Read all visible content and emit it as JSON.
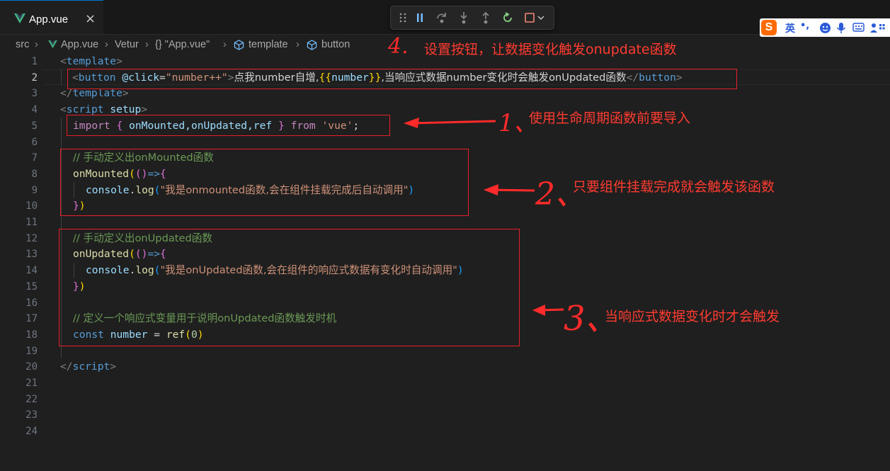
{
  "tab": {
    "filename": "App.vue",
    "close": "×"
  },
  "debug_toolbar": {
    "icons": [
      "drag-handle",
      "pause",
      "step-over",
      "step-into",
      "step-out",
      "restart",
      "stop"
    ]
  },
  "ime": {
    "mode": "英",
    "punct": "•,"
  },
  "breadcrumb": [
    "src",
    "App.vue",
    "Vetur",
    "{} \"App.vue\"",
    "template",
    "button"
  ],
  "gutter": {
    "line_numbers": [
      "1",
      "2",
      "3",
      "4",
      "5",
      "6",
      "7",
      "8",
      "9",
      "10",
      "11",
      "12",
      "13",
      "14",
      "15",
      "16",
      "17",
      "18",
      "19",
      "20",
      "21",
      "22",
      "23",
      "24"
    ],
    "active_line": "2"
  },
  "code": {
    "l1": {
      "open": "<",
      "tag": "template",
      "close": ">"
    },
    "l2": {
      "open": "<",
      "tag": "button",
      "attr": "@click",
      "eq": "=",
      "val": "\"number++\"",
      "gt": ">",
      "text": "点我number自增,",
      "mus_open": "{{",
      "var": "number",
      "mus_close": "}}",
      "text2": ",当响应式数据number变化时会触发onUpdated函数",
      "end_open": "</",
      "end_tag": "button",
      "end_close": ">"
    },
    "l3": {
      "open": "</",
      "tag": "template",
      "close": ">"
    },
    "l4": {
      "open": "<",
      "tag": "script",
      "attr": "setup",
      "close": ">"
    },
    "l5": {
      "kw": "import",
      "b1": "{",
      "names": " onMounted,onUpdated,ref ",
      "b2": "}",
      "from": "from",
      "mod": "'vue'",
      "semi": ";"
    },
    "l7": "// 手动定义出onMounted函数",
    "l8": {
      "fn": "onMounted",
      "p1": "(",
      "p2": "()",
      "arrow": "=>",
      "b": "{"
    },
    "l9": {
      "obj": "console",
      "dot": ".",
      "fn": "log",
      "p1": "(",
      "str": "\"我是onmounted函数,会在组件挂载完成后自动调用\"",
      "p2": ")"
    },
    "l10": {
      "b": "}",
      "p": ")"
    },
    "l12": "// 手动定义出onUpdated函数",
    "l13": {
      "fn": "onUpdated",
      "p1": "(",
      "p2": "()",
      "arrow": "=>",
      "b": "{"
    },
    "l14": {
      "obj": "console",
      "dot": ".",
      "fn": "log",
      "p1": "(",
      "str": "\"我是onUpdated函数,会在组件的响应式数据有变化时自动调用\"",
      "p2": ")"
    },
    "l15": {
      "b": "}",
      "p": ")"
    },
    "l17": "// 定义一个响应式变量用于说明onUpdated函数触发时机",
    "l18": {
      "kw": "const",
      "var": "number",
      "eq": " = ",
      "fn": "ref",
      "p1": "(",
      "num": "0",
      "p2": ")"
    },
    "l20": {
      "open": "</",
      "tag": "script",
      "close": ">"
    }
  },
  "annotations": {
    "a1": {
      "num": "1、",
      "text": "使用生命周期函数前要导入"
    },
    "a2": {
      "num": "2、",
      "text": "只要组件挂载完成就会触发该函数"
    },
    "a3": {
      "num": "3、",
      "text": "当响应式数据变化时才会触发"
    },
    "a4": {
      "num": "4.",
      "text": "设置按钮，让数据变化触发onupdate函数"
    }
  },
  "colors": {
    "annotation_red": "#e5202a",
    "tab_accent": "#0078d4",
    "editor_bg": "#1f1f1f"
  }
}
